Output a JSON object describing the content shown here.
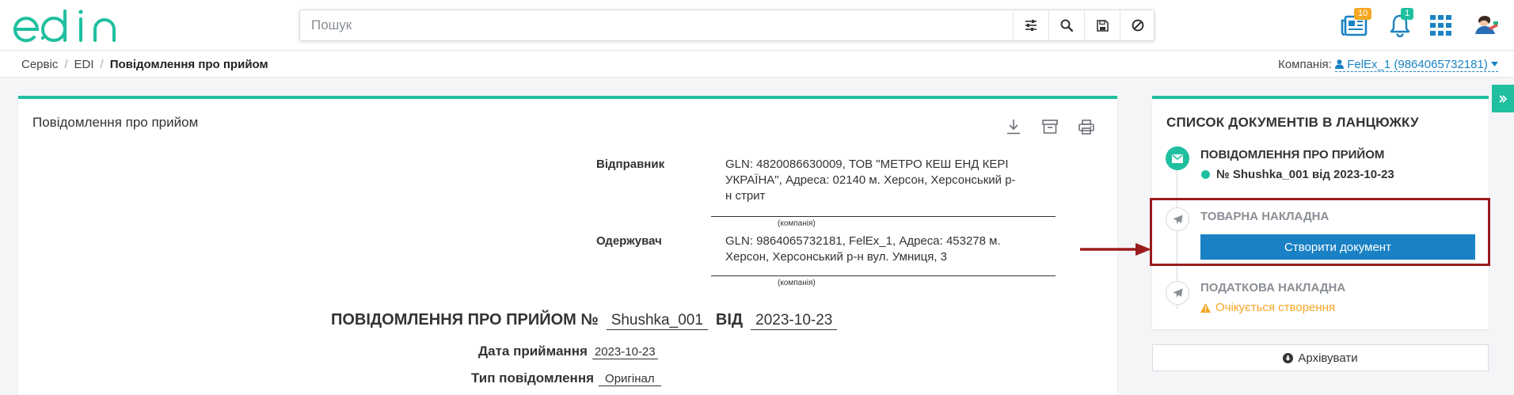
{
  "header": {
    "logo_text": "edin",
    "search": {
      "placeholder": "Пошук",
      "value": ""
    },
    "news_badge": "10",
    "notif_badge": "1"
  },
  "breadcrumb": {
    "items": [
      "Сервіс",
      "EDI"
    ],
    "current": "Повідомлення про прийом"
  },
  "company": {
    "label": "Компанія:",
    "value": "FelEx_1 (9864065732181)"
  },
  "document": {
    "card_title": "Повідомлення про прийом",
    "sender_label": "Відправник",
    "sender_value": "GLN: 4820086630009, ТОВ \"МЕТРО КЕШ ЕНД КЕРІ УКРАЇНА\", Адреса: 02140 м. Херсон, Херсонський р-н стрит",
    "company_caption": "(компанія)",
    "receiver_label": "Одержувач",
    "receiver_value": "GLN: 9864065732181, FelEx_1, Адреса: 453278 м. Херсон, Херсонський р-н вул. Умниця, 3",
    "title_prefix": "ПОВІДОМЛЕННЯ ПРО ПРИЙОМ №",
    "number": "Shushka_001",
    "from_label": "ВІД",
    "date": "2023-10-23",
    "accept_date_label": "Дата приймання",
    "accept_date": "2023-10-23",
    "msg_type_label": "Тип повідомлення",
    "msg_type": "Оригінал"
  },
  "chain": {
    "title": "СПИСОК ДОКУМЕНТІВ В ЛАНЦЮЖКУ",
    "steps": [
      {
        "name": "ПОВІДОМЛЕННЯ ПРО ПРИЙОМ",
        "sub": "№ Shushka_001 від 2023-10-23"
      },
      {
        "name": "ТОВАРНА НАКЛАДНА",
        "button": "Створити документ"
      },
      {
        "name": "ПОДАТКОВА НАКЛАДНА",
        "sub": "Очікується створення"
      }
    ]
  },
  "archive_label": "Архівувати",
  "colors": {
    "accent": "#1fbf9f",
    "primary_button": "#1a82c4",
    "warning": "#f5a623",
    "highlight": "#9b1c1c"
  }
}
